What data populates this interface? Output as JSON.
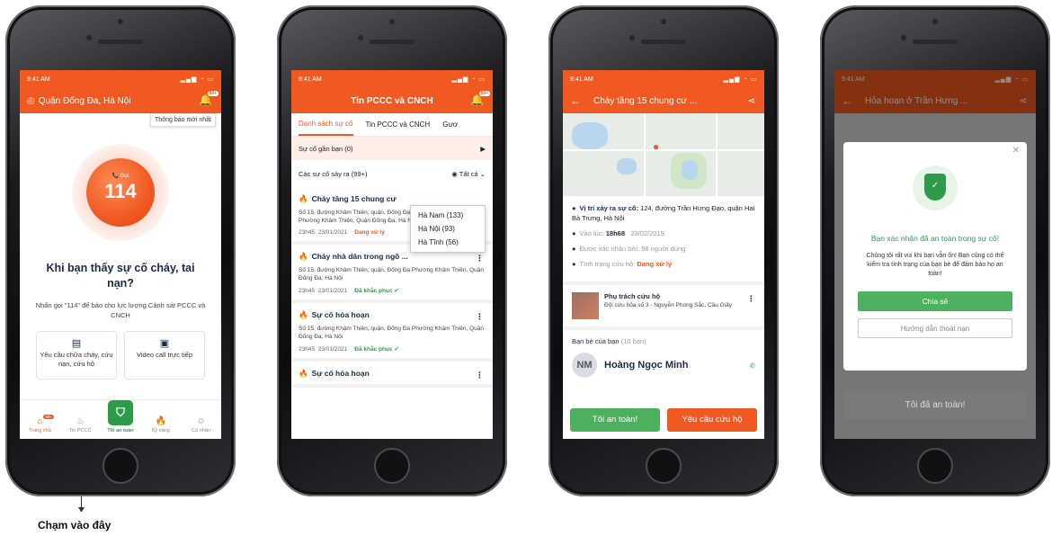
{
  "status_time": "9:41 AM",
  "screen1": {
    "location": "Quận Đống Đa, Hà Nội",
    "bell_badge": "99+",
    "tooltip": "Thông báo mới nhất",
    "call_label": "Gọi",
    "call_number": "114",
    "headline": "Khi bạn thấy sự cố cháy, tai nạn?",
    "subtext": "Nhấn gọi \"114\" để báo cho lực lượng Cảnh sát PCCC và CNCH",
    "card1": "Yêu cầu chữa cháy, cứu nạn, cứu hộ",
    "card2": "Video call trực tiếp",
    "tab_badge": "99+",
    "tabs": [
      "Trang chủ",
      "Tin PCCC",
      "Tôi an toàn",
      "Kỹ năng",
      "Cá nhân"
    ]
  },
  "screen2": {
    "title": "Tin PCCC và CNCH",
    "subtabs": [
      "Danh sách sự cố",
      "Tin PCCC và CNCH",
      "Gươ"
    ],
    "nearby": "Sự cố gần bạn (0)",
    "occurring": "Các sự cố sảy ra (99+)",
    "filter_all": "Tất cả",
    "dropdown": [
      "Hà Nam (133)",
      "Hà Nội (93)",
      "Hà Tĩnh (56)"
    ],
    "items": [
      {
        "title": "Cháy tầng 15 chung cư",
        "address": "Số 15, đường Khâm Thiên, quận, Đống Đa Phường Khâm Thiên, Quận Đống Đa, Hà Nội",
        "time": "23h45",
        "date": "23/01/2021",
        "status": "Đang xử lý"
      },
      {
        "title": "Cháy nhà dân trong ngõ ...",
        "address": "Số 15, đường Khâm Thiên, quận, Đống Đa Phường Khâm Thiên, Quận Đống Đa, Hà Nội",
        "time": "23h45",
        "date": "23/01/2021",
        "status": "Đã khắc phục"
      },
      {
        "title": "Sự cố hỏa hoạn",
        "address": "Số 15, đường Khâm Thiên, quận, Đống Đa Phường Khâm Thiên, Quận Đống Đa, Hà Nội",
        "time": "23h45",
        "date": "23/01/2021",
        "status": "Đã khắc phục"
      },
      {
        "title": "Sự cố hỏa hoạn"
      }
    ]
  },
  "screen3": {
    "title": "Cháy tầng 15 chung cư ...",
    "location_label": "Vị trí xảy ra sự cố:",
    "location_value": "124, đường Trần Hưng Đạo, quận Hai Bà Trưng, Hà Nội",
    "time_label": "Vào lúc:",
    "time_value": "18h68",
    "date_value": "23/02/2019",
    "confirm_label": "Được xác nhận bởi:",
    "confirm_value": "58 người dùng",
    "rescue_label": "Tình trạng cứu hộ:",
    "rescue_value": "Đang xử lý",
    "responsible_title": "Phụ trách cứu hộ",
    "responsible_unit": "Đội cứu hỏa số 3 - Nguyễn Phong Sắc, Cầu Giấy",
    "friends_label": "Bạn bè của bạn",
    "friends_count": "(10 bạn)",
    "friend_initials": "NM",
    "friend_name": "Hoàng Ngọc Minh",
    "safe_btn": "Tôi an toàn!",
    "rescue_btn": "Yêu cầu cứu hộ"
  },
  "screen4": {
    "title": "Hỏa hoạn ở Trần Hưng ...",
    "confirm_title": "Bạn xác nhận đã an toàn trong sự cố!",
    "message": "Chúng tôi rất vui khi bạn vẫn ổn! Bạn cũng có thể kiểm tra tình trạng của bạn bè để đảm bảo họ an toàn!",
    "share_btn": "Chia sẻ",
    "guide_btn": "Hướng dẫn thoát nạn",
    "safe_btn": "Tôi đã an toàn!"
  },
  "caption": "Chạm vào đây"
}
